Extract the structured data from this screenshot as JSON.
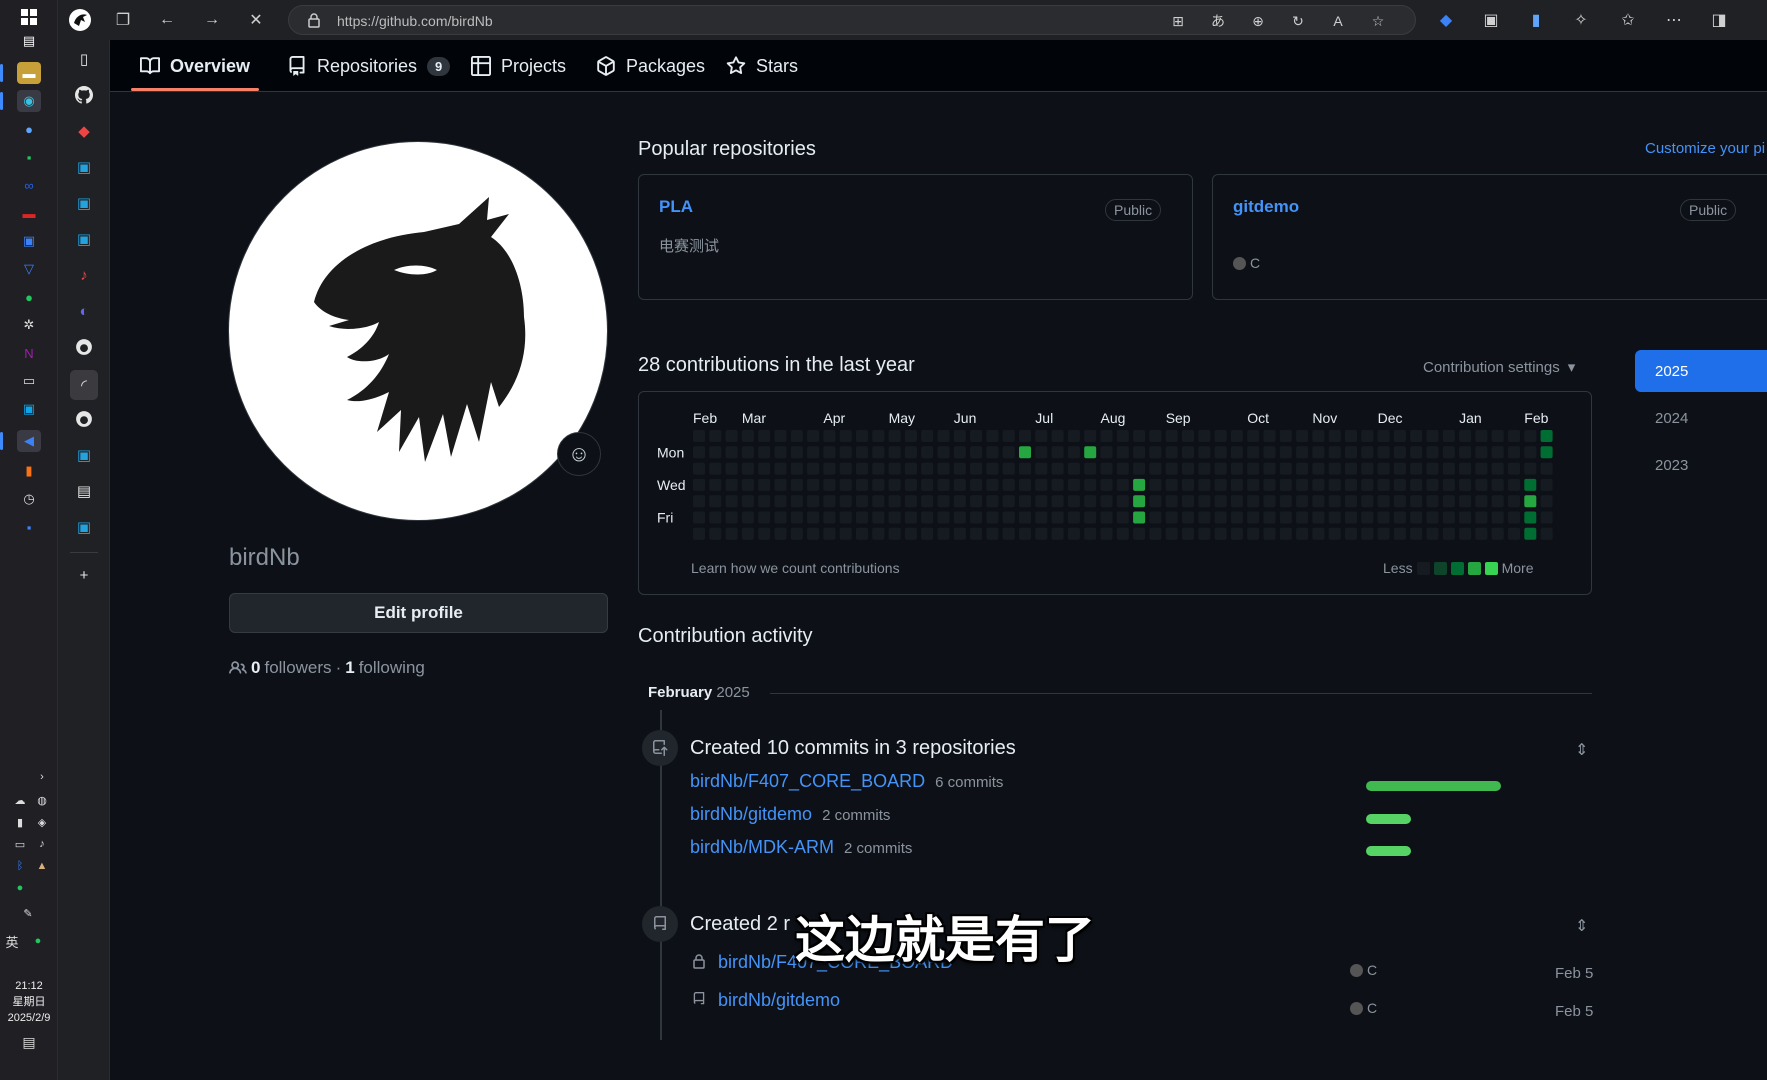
{
  "browser": {
    "url": "https://github.com/birdNb"
  },
  "taskbar": {
    "clock_time": "21:12",
    "clock_day": "星期日",
    "clock_date": "2025/2/9",
    "ime": "英"
  },
  "tabs": [
    {
      "label": "Overview"
    },
    {
      "label": "Repositories",
      "count": "9"
    },
    {
      "label": "Projects"
    },
    {
      "label": "Packages"
    },
    {
      "label": "Stars"
    }
  ],
  "profile": {
    "username": "birdNb",
    "edit_label": "Edit profile",
    "followers_count": "0",
    "followers_label": "followers",
    "sep": "·",
    "following_count": "1",
    "following_label": "following"
  },
  "popular": {
    "title": "Popular repositories",
    "customize": "Customize your pi",
    "repos": [
      {
        "name": "PLA",
        "visibility": "Public",
        "description": "电赛测试",
        "language": ""
      },
      {
        "name": "gitdemo",
        "visibility": "Public",
        "description": "",
        "language": "C"
      }
    ]
  },
  "contributions": {
    "title": "28 contributions in the last year",
    "settings_label": "Contribution settings",
    "months": [
      "Feb",
      "Mar",
      "Apr",
      "May",
      "Jun",
      "Jul",
      "Aug",
      "Sep",
      "Oct",
      "Nov",
      "Dec",
      "Jan",
      "Feb"
    ],
    "days": [
      "Mon",
      "Wed",
      "Fri"
    ],
    "learn_link": "Learn how we count contributions",
    "legend_less": "Less",
    "legend_more": "More",
    "colors": {
      "empty": "#161b22",
      "l1": "#0e4429",
      "l2": "#006d32",
      "l3": "#26a641",
      "l4": "#39d353"
    },
    "active_cells": [
      {
        "week": 20,
        "day": 1,
        "level": 3
      },
      {
        "week": 24,
        "day": 1,
        "level": 3
      },
      {
        "week": 27,
        "day": 3,
        "level": 3
      },
      {
        "week": 27,
        "day": 4,
        "level": 3
      },
      {
        "week": 27,
        "day": 5,
        "level": 3
      },
      {
        "week": 52,
        "day": 0,
        "level": 2
      },
      {
        "week": 52,
        "day": 1,
        "level": 2
      },
      {
        "week": 51,
        "day": 3,
        "level": 2
      },
      {
        "week": 51,
        "day": 4,
        "level": 3
      },
      {
        "week": 51,
        "day": 5,
        "level": 2
      },
      {
        "week": 51,
        "day": 6,
        "level": 2
      }
    ]
  },
  "years": [
    "2025",
    "2024",
    "2023"
  ],
  "activity": {
    "title": "Contribution activity",
    "month": "February",
    "year": "2025",
    "commits_title": "Created 10 commits in 3 repositories",
    "commit_rows": [
      {
        "repo": "birdNb/F407_CORE_BOARD",
        "count": "6 commits",
        "fraction": 0.6
      },
      {
        "repo": "birdNb/gitdemo",
        "count": "2 commits",
        "fraction": 0.2
      },
      {
        "repo": "birdNb/MDK-ARM",
        "count": "2 commits",
        "fraction": 0.2
      }
    ],
    "created_title_visible": "Created 2 r",
    "created_rows": [
      {
        "repo": "birdNb/F407_CORE_BOARD",
        "language": "C",
        "date": "Feb 5",
        "icon": "lock-icon"
      },
      {
        "repo": "birdNb/gitdemo",
        "language": "C",
        "date": "Feb 5",
        "icon": "repo-icon"
      }
    ]
  },
  "subtitle": "这边就是有了"
}
